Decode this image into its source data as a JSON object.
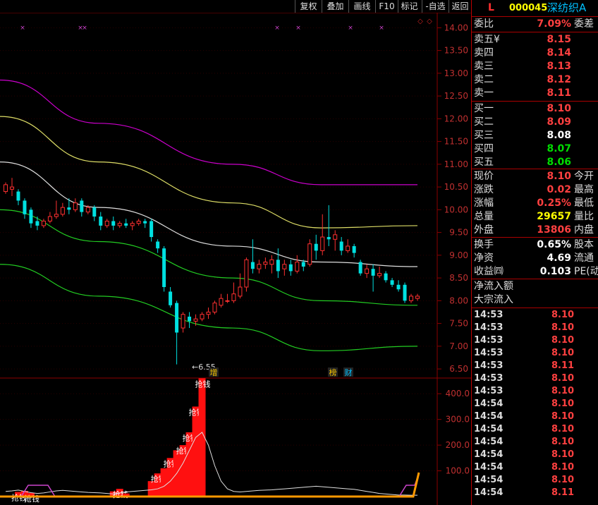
{
  "toolbar": {
    "buttons": [
      "复权",
      "叠加",
      "画线",
      "F10",
      "标记",
      "-自选",
      "返回"
    ]
  },
  "header": {
    "flag": "L",
    "code": "000045",
    "name": "深纺织A"
  },
  "price_axis": [
    "14.00",
    "13.50",
    "13.00",
    "12.50",
    "12.00",
    "11.50",
    "11.00",
    "10.50",
    "10.00",
    "9.50",
    "9.00",
    "8.50",
    "8.00",
    "7.50",
    "7.00",
    "6.50"
  ],
  "volume_axis": [
    "400.0",
    "300.0",
    "200.0",
    "100.0"
  ],
  "low_marker": "←6.55",
  "event_markers": [
    {
      "text": "增",
      "color": "#f0c000"
    },
    {
      "text": "榜",
      "color": "#f0c000"
    },
    {
      "text": "财",
      "color": "#00c0ff"
    }
  ],
  "indicator_label": "抢钱",
  "order_ratio": {
    "label": "委比",
    "value": "7.09%",
    "label2": "委差"
  },
  "asks": [
    {
      "label": "卖五¥",
      "price": "8.15"
    },
    {
      "label": "卖四",
      "price": "8.14"
    },
    {
      "label": "卖三",
      "price": "8.13"
    },
    {
      "label": "卖二",
      "price": "8.12"
    },
    {
      "label": "卖一",
      "price": "8.11"
    }
  ],
  "bids": [
    {
      "label": "买一",
      "price": "8.10",
      "color": "#ff4040"
    },
    {
      "label": "买二",
      "price": "8.09",
      "color": "#ff4040"
    },
    {
      "label": "买三",
      "price": "8.08",
      "color": "#ffffff"
    },
    {
      "label": "买四",
      "price": "8.07",
      "color": "#00dd00"
    },
    {
      "label": "买五",
      "price": "8.06",
      "color": "#00dd00"
    }
  ],
  "stats": [
    {
      "label": "现价",
      "value": "8.10",
      "color": "#ff4040",
      "label2": "今开"
    },
    {
      "label": "涨跌",
      "value": "0.02",
      "color": "#ff4040",
      "label2": "最高"
    },
    {
      "label": "涨幅",
      "value": "0.25%",
      "color": "#ff4040",
      "label2": "最低"
    },
    {
      "label": "总量",
      "value": "29657",
      "color": "#ffff00",
      "label2": "量比"
    },
    {
      "label": "外盘",
      "value": "13806",
      "color": "#ff4040",
      "label2": "内盘"
    }
  ],
  "stats2": [
    {
      "label": "换手",
      "value": "0.65%",
      "color": "#ffffff",
      "label2": "股本"
    },
    {
      "label": "净资",
      "value": "4.69",
      "color": "#ffffff",
      "label2": "流通"
    },
    {
      "label": "收益㈣",
      "value": "0.103",
      "color": "#ffffff",
      "label2": "PE(动"
    }
  ],
  "flow": [
    "净流入额",
    "大宗流入"
  ],
  "ticks": [
    {
      "time": "14:53",
      "price": "8.10"
    },
    {
      "time": "14:53",
      "price": "8.10"
    },
    {
      "time": "14:53",
      "price": "8.10"
    },
    {
      "time": "14:53",
      "price": "8.10"
    },
    {
      "time": "14:53",
      "price": "8.11"
    },
    {
      "time": "14:53",
      "price": "8.10"
    },
    {
      "time": "14:53",
      "price": "8.10"
    },
    {
      "time": "14:54",
      "price": "8.10"
    },
    {
      "time": "14:54",
      "price": "8.10"
    },
    {
      "time": "14:54",
      "price": "8.10"
    },
    {
      "time": "14:54",
      "price": "8.10"
    },
    {
      "time": "14:54",
      "price": "8.10"
    },
    {
      "time": "14:54",
      "price": "8.10"
    },
    {
      "time": "14:54",
      "price": "8.10"
    },
    {
      "time": "14:54",
      "price": "8.11"
    }
  ],
  "colors": {
    "up": "#ff3030",
    "down": "#00e0e0",
    "grid": "#8b0000"
  },
  "chart_data": {
    "type": "candlestick",
    "ylim": [
      6.3,
      14.3
    ],
    "candles": [
      [
        10.4,
        10.55,
        10.6,
        10.35
      ],
      [
        10.45,
        10.5,
        10.7,
        10.3
      ],
      [
        10.4,
        10.2,
        10.45,
        10.1
      ],
      [
        10.2,
        9.9,
        10.25,
        9.8
      ],
      [
        10.0,
        9.7,
        10.05,
        9.6
      ],
      [
        9.75,
        9.65,
        9.85,
        9.55
      ],
      [
        9.65,
        9.75,
        9.8,
        9.6
      ],
      [
        9.75,
        9.85,
        9.95,
        9.7
      ],
      [
        9.85,
        9.9,
        10.2,
        9.8
      ],
      [
        9.9,
        10.05,
        10.15,
        9.85
      ],
      [
        10.05,
        10.0,
        10.25,
        9.9
      ],
      [
        10.0,
        10.15,
        10.25,
        9.95
      ],
      [
        10.2,
        9.95,
        10.25,
        9.85
      ],
      [
        9.95,
        10.05,
        10.1,
        9.9
      ],
      [
        10.05,
        9.85,
        10.1,
        9.75
      ],
      [
        9.85,
        9.65,
        9.95,
        9.55
      ],
      [
        9.65,
        9.75,
        9.8,
        9.6
      ],
      [
        9.75,
        9.65,
        9.85,
        9.55
      ],
      [
        9.65,
        9.7,
        9.75,
        9.6
      ],
      [
        9.7,
        9.65,
        9.8,
        9.6
      ],
      [
        9.65,
        9.7,
        9.75,
        9.55
      ],
      [
        9.7,
        9.75,
        9.8,
        9.65
      ],
      [
        9.75,
        9.7,
        9.8,
        9.6
      ],
      [
        9.75,
        9.4,
        9.8,
        9.3
      ],
      [
        9.3,
        9.15,
        9.35,
        9.05
      ],
      [
        9.15,
        8.3,
        9.2,
        8.2
      ],
      [
        8.2,
        7.9,
        8.3,
        7.85
      ],
      [
        7.95,
        7.3,
        8.0,
        6.6
      ],
      [
        7.4,
        7.7,
        7.75,
        7.3
      ],
      [
        7.65,
        7.55,
        7.75,
        7.4
      ],
      [
        7.55,
        7.6,
        7.7,
        7.45
      ],
      [
        7.6,
        7.7,
        7.75,
        7.55
      ],
      [
        7.7,
        7.75,
        7.85,
        7.6
      ],
      [
        7.75,
        7.95,
        8.0,
        7.7
      ],
      [
        7.9,
        8.05,
        8.15,
        7.85
      ],
      [
        8.0,
        8.0,
        8.15,
        7.95
      ],
      [
        8.0,
        8.15,
        8.4,
        7.95
      ],
      [
        8.1,
        8.3,
        8.6,
        8.05
      ],
      [
        8.3,
        8.9,
        8.95,
        8.2
      ],
      [
        8.85,
        8.7,
        9.35,
        8.6
      ],
      [
        8.7,
        8.8,
        8.9,
        8.6
      ],
      [
        8.8,
        8.85,
        8.95,
        8.7
      ],
      [
        8.8,
        8.9,
        9.0,
        8.6
      ],
      [
        8.9,
        8.65,
        9.15,
        8.5
      ],
      [
        8.7,
        8.8,
        8.9,
        8.55
      ],
      [
        8.8,
        8.65,
        8.9,
        8.55
      ],
      [
        8.65,
        8.85,
        9.0,
        8.6
      ],
      [
        8.85,
        8.75,
        8.9,
        8.65
      ],
      [
        8.8,
        9.25,
        9.35,
        8.75
      ],
      [
        9.25,
        9.1,
        9.45,
        8.9
      ],
      [
        9.1,
        9.4,
        9.9,
        9.0
      ],
      [
        9.4,
        9.35,
        10.1,
        9.2
      ],
      [
        9.35,
        9.45,
        9.55,
        9.1
      ],
      [
        9.3,
        9.1,
        9.4,
        9.0
      ],
      [
        9.1,
        9.2,
        9.35,
        9.05
      ],
      [
        9.2,
        9.05,
        9.25,
        8.95
      ],
      [
        8.85,
        8.6,
        8.9,
        8.55
      ],
      [
        8.6,
        8.7,
        8.8,
        8.5
      ],
      [
        8.7,
        8.55,
        8.8,
        8.2
      ],
      [
        8.55,
        8.6,
        8.75,
        8.5
      ],
      [
        8.6,
        8.45,
        8.65,
        8.4
      ],
      [
        8.45,
        8.35,
        8.5,
        8.3
      ],
      [
        8.35,
        8.25,
        8.45,
        8.2
      ],
      [
        8.35,
        8.0,
        8.4,
        7.95
      ],
      [
        8.0,
        8.1,
        8.15,
        7.95
      ],
      [
        8.05,
        8.1,
        8.15,
        8.0
      ]
    ],
    "ma_bands": [
      {
        "color": "#cc00cc",
        "values": [
          12.85,
          11.9,
          11.0,
          10.55,
          10.55
        ]
      },
      {
        "color": "#dddd66",
        "values": [
          12.05,
          11.05,
          10.15,
          9.6,
          9.65
        ]
      },
      {
        "color": "#dddddd",
        "values": [
          11.05,
          10.05,
          9.2,
          8.85,
          8.75
        ]
      },
      {
        "color": "#22cc22",
        "values": [
          10.0,
          9.3,
          8.5,
          8.0,
          7.9
        ]
      },
      {
        "color": "#22cc22",
        "values": [
          8.8,
          8.1,
          7.4,
          6.9,
          7.0
        ]
      }
    ],
    "volume_bars": [
      0,
      0,
      18,
      22,
      14,
      0,
      0,
      0,
      0,
      0,
      0,
      0,
      0,
      0,
      0,
      0,
      0,
      20,
      30,
      12,
      0,
      0,
      0,
      60,
      90,
      110,
      150,
      180,
      200,
      250,
      350,
      460,
      0,
      0,
      0,
      0,
      0,
      0,
      0,
      0,
      0,
      0,
      0,
      0,
      0,
      0,
      0,
      0,
      0,
      0,
      0,
      0,
      0,
      0,
      0,
      0,
      0,
      0,
      0,
      0,
      0,
      0,
      0,
      0,
      0,
      0
    ],
    "volume_ylim": [
      0,
      450
    ]
  }
}
